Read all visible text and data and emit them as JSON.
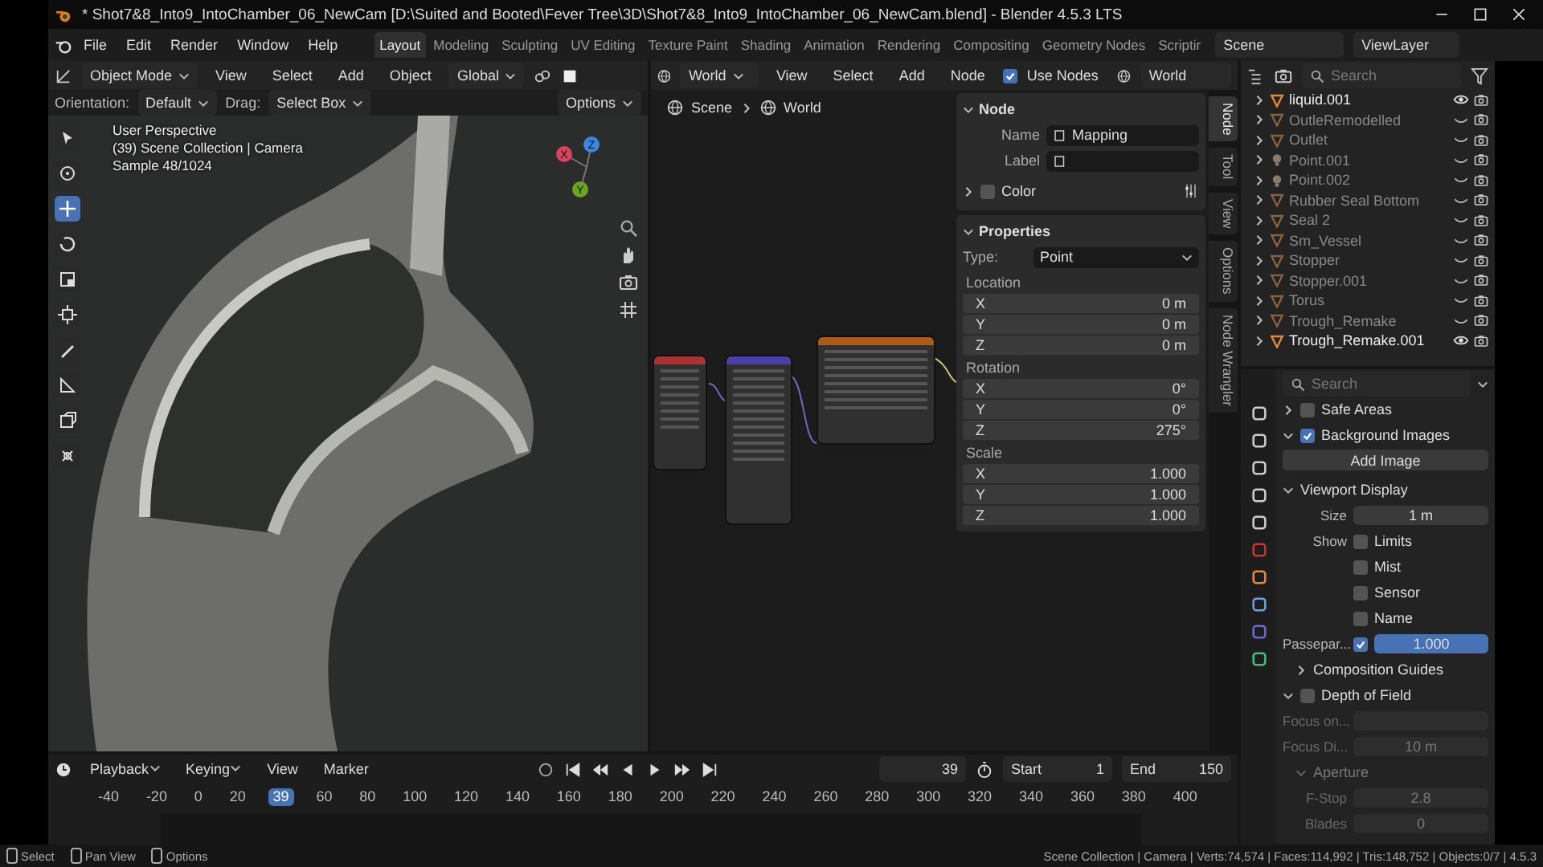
{
  "window": {
    "title": "* Shot7&8_Into9_IntoChamber_06_NewCam [D:\\Suited and Booted\\Fever Tree\\3D\\Shot7&8_Into9_IntoChamber_06_NewCam.blend] - Blender 4.5.3 LTS"
  },
  "menu": [
    "File",
    "Edit",
    "Render",
    "Window",
    "Help"
  ],
  "workspaces": [
    {
      "label": "Layout",
      "selected": true
    },
    {
      "label": "Modeling",
      "selected": false
    },
    {
      "label": "Sculpting",
      "selected": false
    },
    {
      "label": "UV Editing",
      "selected": false
    },
    {
      "label": "Texture Paint",
      "selected": false
    },
    {
      "label": "Shading",
      "selected": false
    },
    {
      "label": "Animation",
      "selected": false
    },
    {
      "label": "Rendering",
      "selected": false
    },
    {
      "label": "Compositing",
      "selected": false
    },
    {
      "label": "Geometry Nodes",
      "selected": false
    },
    {
      "label": "Scriptir",
      "selected": false
    }
  ],
  "scene": "Scene",
  "view_layer": "ViewLayer",
  "viewport": {
    "mode": "Object Mode",
    "menu": [
      "View",
      "Select",
      "Add",
      "Object"
    ],
    "transform": "Global",
    "orientation_label": "Orientation:",
    "orientation": "Default",
    "drag_label": "Drag:",
    "drag": "Select Box",
    "options": "Options",
    "overlay": [
      "User Perspective",
      "(39) Scene Collection | Camera",
      "Sample 48/1024"
    ],
    "gizmo": [
      {
        "axis": "X",
        "color": "#d9435e"
      },
      {
        "axis": "Y",
        "color": "#6ba325"
      },
      {
        "axis": "Z",
        "color": "#3b86e0"
      }
    ]
  },
  "node_editor": {
    "world": "World",
    "menu": [
      "View",
      "Select",
      "Add",
      "Node"
    ],
    "use_nodes": {
      "label": "Use Nodes",
      "checked": true
    },
    "world_slot": "World",
    "breadcrumb": [
      "Scene",
      "World"
    ],
    "sidebar_tabs": [
      {
        "label": "Node",
        "selected": true
      },
      {
        "label": "Tool",
        "selected": false
      },
      {
        "label": "View",
        "selected": false
      },
      {
        "label": "Options",
        "selected": false
      },
      {
        "label": "Node Wrangler",
        "selected": false
      }
    ],
    "node_panel": {
      "title": "Node",
      "expanded": true,
      "name_label": "Name",
      "name": "Mapping",
      "label_label": "Label",
      "color_label": "Color",
      "color_expanded": false
    },
    "properties_panel": {
      "title": "Properties",
      "expanded": true,
      "type_label": "Type:",
      "type": "Point",
      "groups": [
        {
          "title": "Location",
          "fields": [
            {
              "axis": "X",
              "value": "0 m"
            },
            {
              "axis": "Y",
              "value": "0 m"
            },
            {
              "axis": "Z",
              "value": "0 m"
            }
          ]
        },
        {
          "title": "Rotation",
          "fields": [
            {
              "axis": "X",
              "value": "0°"
            },
            {
              "axis": "Y",
              "value": "0°"
            },
            {
              "axis": "Z",
              "value": "275°"
            }
          ]
        },
        {
          "title": "Scale",
          "fields": [
            {
              "axis": "X",
              "value": "1.000"
            },
            {
              "axis": "Y",
              "value": "1.000"
            },
            {
              "axis": "Z",
              "value": "1.000"
            }
          ]
        }
      ]
    }
  },
  "outliner": {
    "search_placeholder": "Search",
    "items": [
      {
        "name": "liquid.001",
        "kind": "mesh",
        "visible": true
      },
      {
        "name": "OutleRemodelled",
        "kind": "mesh",
        "visible": false
      },
      {
        "name": "Outlet",
        "kind": "mesh",
        "visible": false
      },
      {
        "name": "Point.001",
        "kind": "light",
        "visible": false
      },
      {
        "name": "Point.002",
        "kind": "light",
        "visible": false
      },
      {
        "name": "Rubber Seal Bottom",
        "kind": "mesh",
        "visible": false
      },
      {
        "name": "Seal 2",
        "kind": "mesh",
        "visible": false
      },
      {
        "name": "Sm_Vessel",
        "kind": "mesh",
        "visible": false
      },
      {
        "name": "Stopper",
        "kind": "mesh",
        "visible": false
      },
      {
        "name": "Stopper.001",
        "kind": "mesh",
        "visible": false
      },
      {
        "name": "Torus",
        "kind": "mesh",
        "visible": false
      },
      {
        "name": "Trough_Remake",
        "kind": "mesh",
        "visible": false
      },
      {
        "name": "Trough_Remake.001",
        "kind": "mesh",
        "visible": true
      }
    ]
  },
  "properties": {
    "search_placeholder": "Search",
    "safe_areas": {
      "label": "Safe Areas",
      "checked": false,
      "expanded": false
    },
    "background_images": {
      "label": "Background Images",
      "checked": true,
      "expanded": true,
      "add_image": "Add Image"
    },
    "viewport_display": {
      "title": "Viewport Display",
      "expanded": true,
      "size_label": "Size",
      "size": "1 m",
      "show_label": "Show",
      "show": [
        {
          "label": "Limits",
          "checked": false
        },
        {
          "label": "Mist",
          "checked": false
        },
        {
          "label": "Sensor",
          "checked": false
        },
        {
          "label": "Name",
          "checked": false
        }
      ],
      "passepartout": {
        "label": "Passepar...",
        "checked": true,
        "value": "1.000",
        "level": 1
      },
      "composition_guides": {
        "label": "Composition Guides",
        "expanded": false
      }
    },
    "depth_of_field": {
      "label": "Depth of Field",
      "checked": false,
      "expanded": true,
      "focus_object_label": "Focus on...",
      "focus_distance_label": "Focus Di...",
      "focus_distance": "10 m",
      "aperture": {
        "title": "Aperture",
        "expanded": true,
        "fstop_label": "F-Stop",
        "fstop": "2.8",
        "blades_label": "Blades",
        "blades": "0"
      }
    }
  },
  "timeline": {
    "menu": [
      "Playback",
      "Keying",
      "View",
      "Marker"
    ],
    "current_frame": "39",
    "start_label": "Start",
    "start": "1",
    "end_label": "End",
    "end": "150",
    "ruler": [
      {
        "label": "-40",
        "selected": false
      },
      {
        "label": "-20",
        "selected": false
      },
      {
        "label": "0",
        "selected": false
      },
      {
        "label": "20",
        "selected": false
      },
      {
        "label": "39",
        "selected": true
      },
      {
        "label": "60",
        "selected": false
      },
      {
        "label": "80",
        "selected": false
      },
      {
        "label": "100",
        "selected": false
      },
      {
        "label": "120",
        "selected": false
      },
      {
        "label": "140",
        "selected": false
      },
      {
        "label": "160",
        "selected": false
      },
      {
        "label": "180",
        "selected": false
      },
      {
        "label": "200",
        "selected": false
      },
      {
        "label": "220",
        "selected": false
      },
      {
        "label": "240",
        "selected": false
      },
      {
        "label": "260",
        "selected": false
      },
      {
        "label": "280",
        "selected": false
      },
      {
        "label": "300",
        "selected": false
      },
      {
        "label": "320",
        "selected": false
      },
      {
        "label": "340",
        "selected": false
      },
      {
        "label": "360",
        "selected": false
      },
      {
        "label": "380",
        "selected": false
      },
      {
        "label": "400",
        "selected": false
      }
    ]
  },
  "status_bar": {
    "hints": [
      "Select",
      "Pan View",
      "Options"
    ],
    "stats": "Scene Collection | Camera | Verts:74,574 | Faces:114,992 | Tris:148,752 | Objects:0/7 | 4.5.3"
  }
}
